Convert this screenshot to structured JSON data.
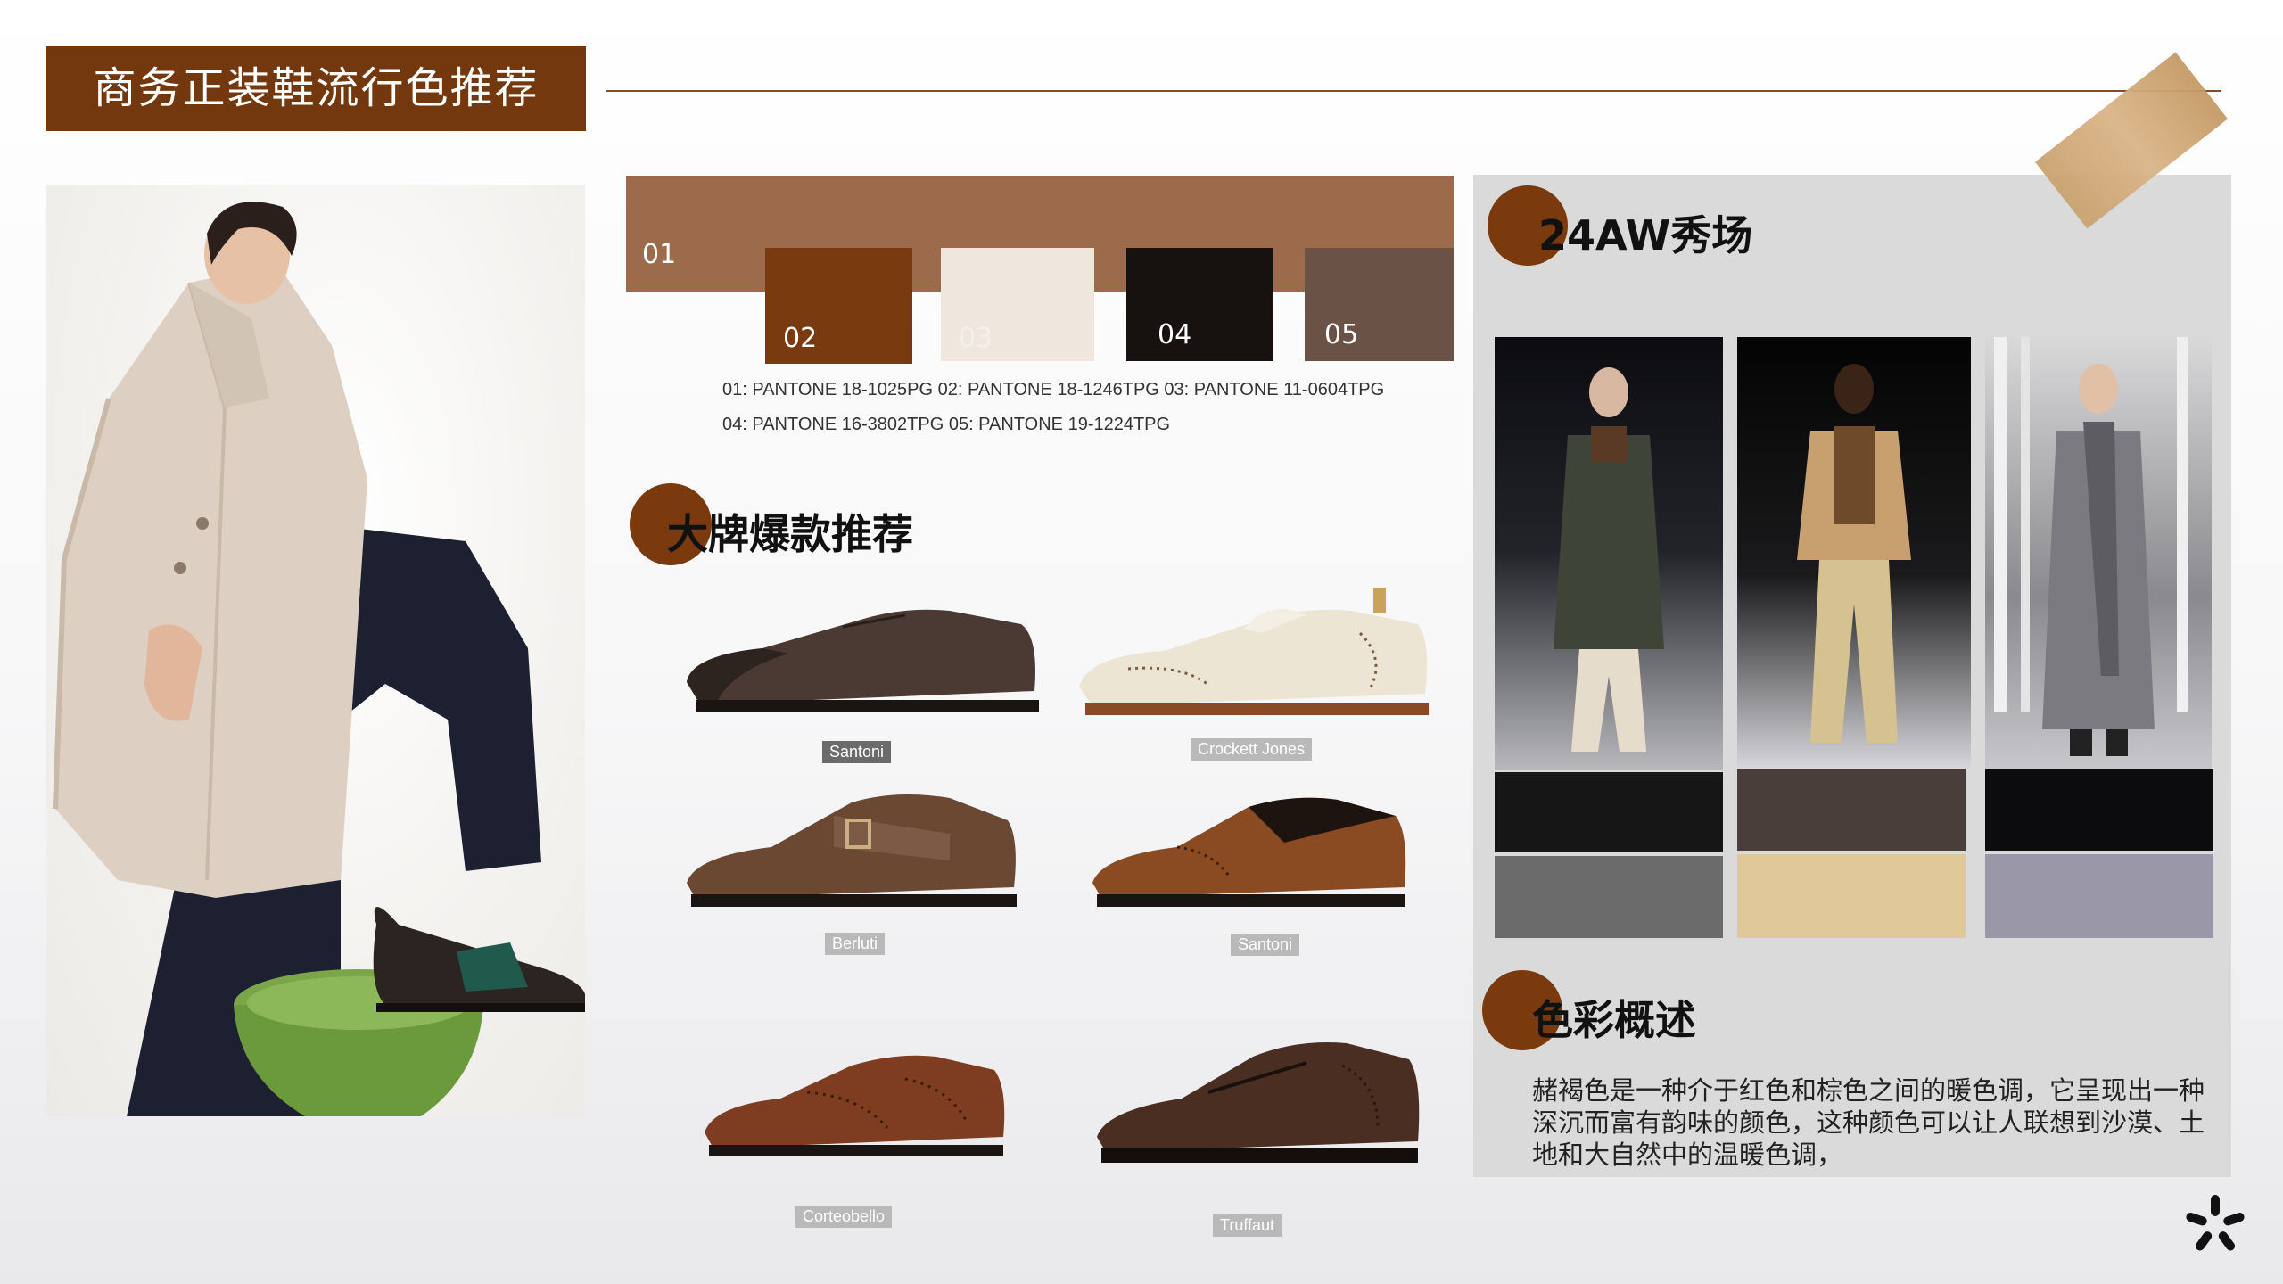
{
  "title": "商务正装鞋流行色推荐",
  "palette": {
    "main_label": "01",
    "swatches": [
      {
        "label": "02",
        "color": "#7a3a10"
      },
      {
        "label": "03",
        "color": "#efe6dd"
      },
      {
        "label": "04",
        "color": "#17120f"
      },
      {
        "label": "05",
        "color": "#6a5246"
      }
    ],
    "main_color": "#9b6b4b",
    "pantone_line1": "01: PANTONE 18-1025PG   02: PANTONE 18-1246TPG  03: PANTONE 11-0604TPG",
    "pantone_line2": "04: PANTONE 16-3802TPG  05: PANTONE 19-1224TPG"
  },
  "brands_section": {
    "heading": "大牌爆款推荐",
    "shoes": [
      {
        "brand": "Santoni",
        "icon": "oxford-shoe-dark-brown"
      },
      {
        "brand": "Crockett Jones",
        "icon": "oxford-shoe-cream"
      },
      {
        "brand": "Berluti",
        "icon": "monk-strap-shoe-brown"
      },
      {
        "brand": "Santoni",
        "icon": "brogue-shoe-burnished"
      },
      {
        "brand": "Corteobello",
        "icon": "brogue-shoe-chestnut"
      },
      {
        "brand": "Truffaut",
        "icon": "oxford-shoe-espresso"
      }
    ]
  },
  "runway_section": {
    "heading": "24AW秀场",
    "looks": [
      {
        "icon": "runway-look-olive-coat",
        "swatch_top": "#161616",
        "swatch_bottom": "#6b6b6b"
      },
      {
        "icon": "runway-look-camel-jacket",
        "swatch_top": "#4a3e3b",
        "swatch_bottom": "#e0c898"
      },
      {
        "icon": "runway-look-grey-coat",
        "swatch_top": "#0c0c0e",
        "swatch_bottom": "#9a97a8"
      }
    ]
  },
  "color_section": {
    "heading": "色彩概述",
    "description": "赭褐色是一种介于红色和棕色之间的暖色调，它呈现出一种深沉而富有韵味的颜色，这种颜色可以让人联想到沙漠、土地和大自然中的温暖色调，"
  },
  "accent_color": "#7a3a0e"
}
